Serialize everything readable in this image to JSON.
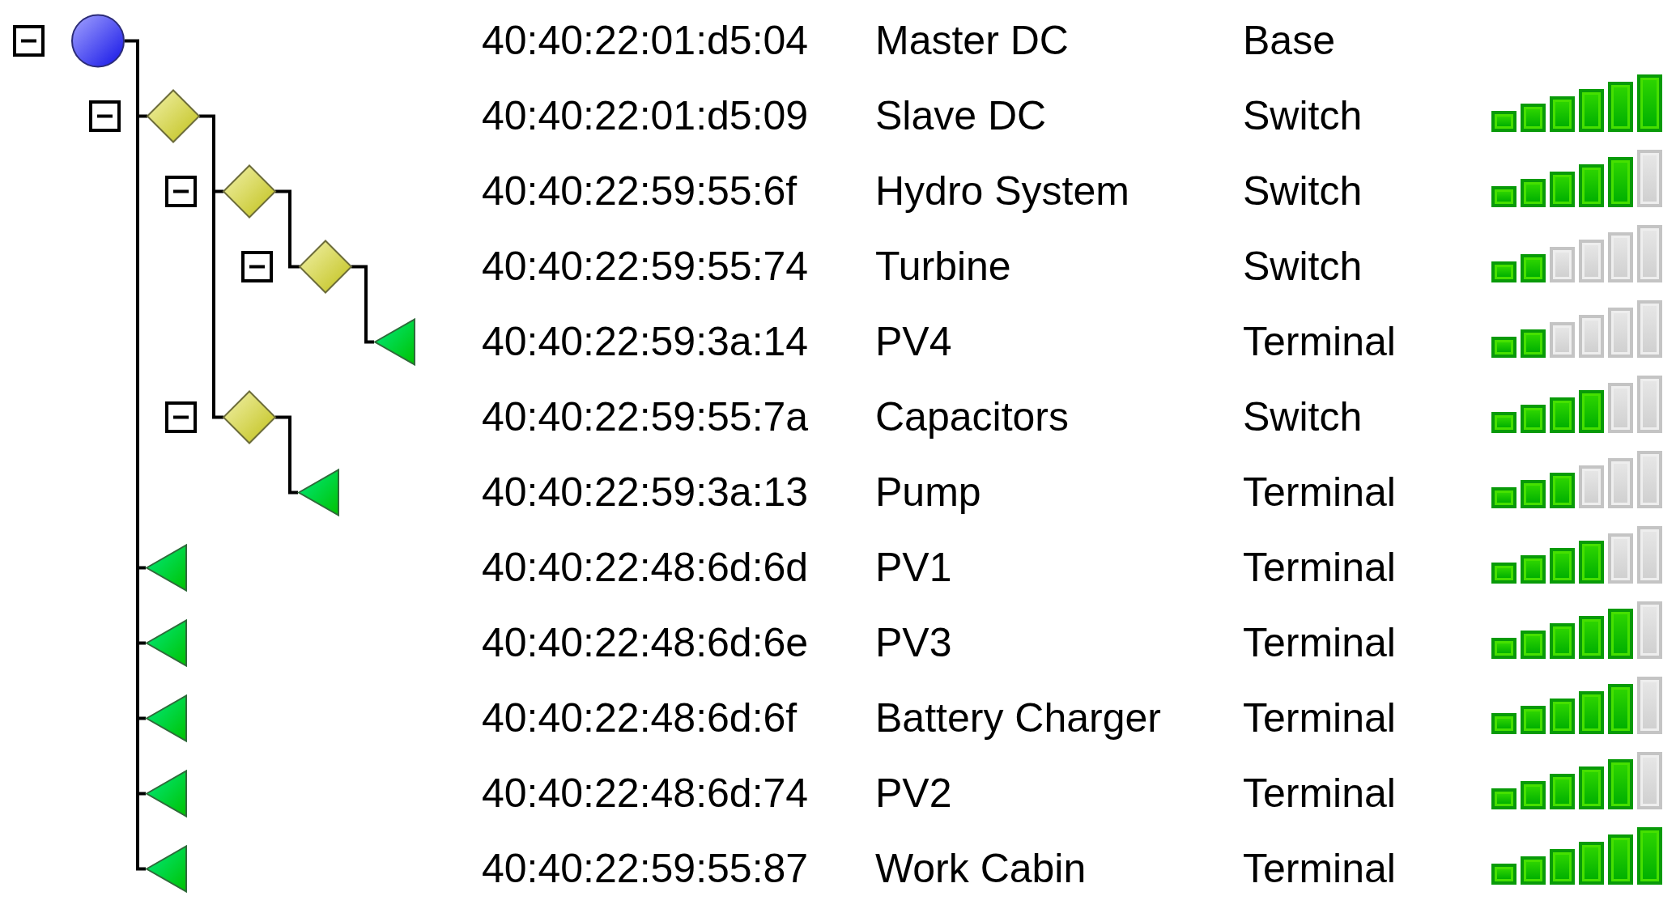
{
  "device_tree": [
    {
      "kind": "base",
      "expanded": true,
      "address": "40:40:22:01:d5:04",
      "name": "Master DC",
      "type": "Base",
      "children": [
        {
          "kind": "switch",
          "expanded": true,
          "address": "40:40:22:01:d5:09",
          "name": "Slave DC",
          "type": "Switch",
          "level": 1,
          "children": [
            {
              "kind": "switch",
              "expanded": true,
              "address": "40:40:22:59:55:6f",
              "name": "Hydro System",
              "type": "Switch",
              "level": 0.833,
              "children": [
                {
                  "kind": "switch",
                  "expanded": true,
                  "address": "40:40:22:59:55:74",
                  "name": "Turbine",
                  "type": "Switch",
                  "level": 0.333,
                  "children": [
                    {
                      "kind": "terminal",
                      "address": "40:40:22:59:3a:14",
                      "name": "PV4",
                      "type": "Terminal",
                      "level": 0.333
                    }
                  ]
                }
              ]
            },
            {
              "kind": "switch",
              "expanded": true,
              "address": "40:40:22:59:55:7a",
              "name": "Capacitors",
              "type": "Switch",
              "level": 0.667,
              "children": [
                {
                  "kind": "terminal",
                  "address": "40:40:22:59:3a:13",
                  "name": "Pump",
                  "type": "Terminal",
                  "level": 0.5
                }
              ]
            }
          ]
        },
        {
          "kind": "terminal",
          "address": "40:40:22:48:6d:6d",
          "name": "PV1",
          "type": "Terminal",
          "level": 0.667
        },
        {
          "kind": "terminal",
          "address": "40:40:22:48:6d:6e",
          "name": "PV3",
          "type": "Terminal",
          "level": 0.833
        },
        {
          "kind": "terminal",
          "address": "40:40:22:48:6d:6f",
          "name": "Battery Charger",
          "type": "Terminal",
          "level": 0.833
        },
        {
          "kind": "terminal",
          "address": "40:40:22:48:6d:74",
          "name": "PV2",
          "type": "Terminal",
          "level": 0.833
        },
        {
          "kind": "terminal",
          "address": "40:40:22:59:55:87",
          "name": "Work Cabin",
          "type": "Terminal",
          "level": 1
        }
      ]
    }
  ]
}
